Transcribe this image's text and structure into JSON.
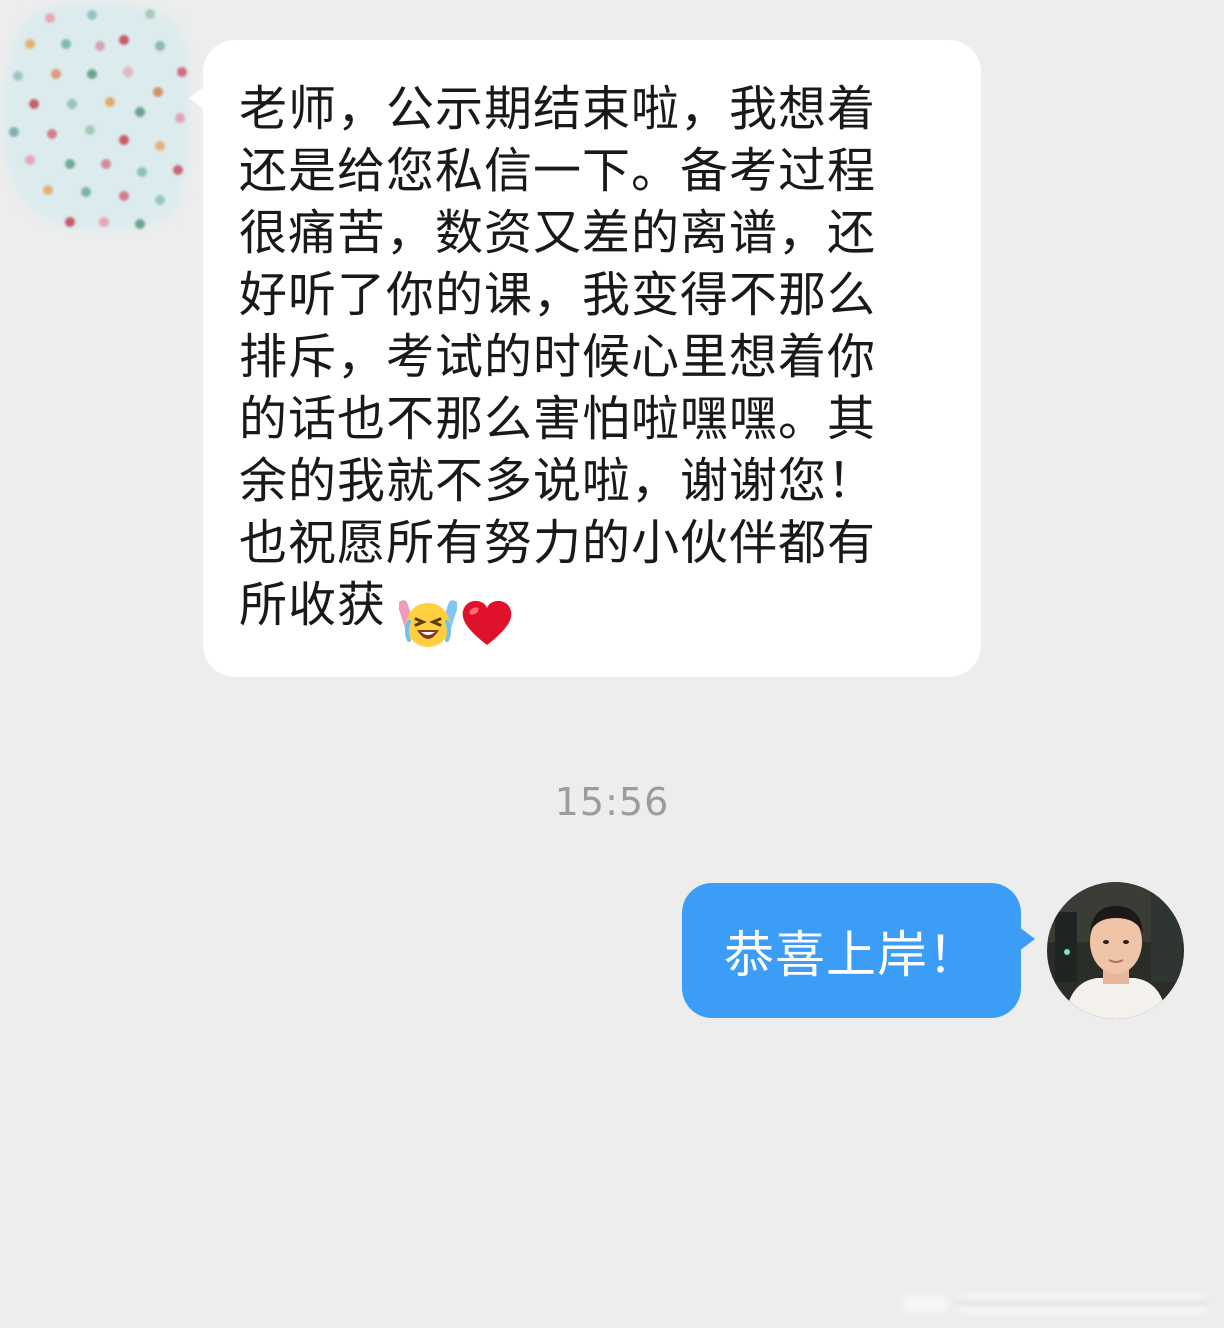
{
  "conversation": {
    "incoming": {
      "text": "老师，公示期结束啦，我想着\n还是给您私信一下。备考过程\n很痛苦，数资又差的离谱，还\n好听了你的课，我变得不那么\n排斥，考试的时候心里想着你\n的话也不那么害怕啦嘿嘿。其\n余的我就不多说啦，谢谢您！\n也祝愿所有努力的小伙伴都有\n所收获",
      "emojis": [
        "laughing-crying-emoji",
        "red-heart-emoji"
      ]
    },
    "timestamp": "15:56",
    "outgoing": {
      "text": "恭喜上岸！"
    }
  },
  "colors": {
    "background": "#ededed",
    "incoming_bubble": "#ffffff",
    "outgoing_bubble": "#3c9df6",
    "text_dark": "#191919",
    "timestamp": "#9c9c9c"
  }
}
